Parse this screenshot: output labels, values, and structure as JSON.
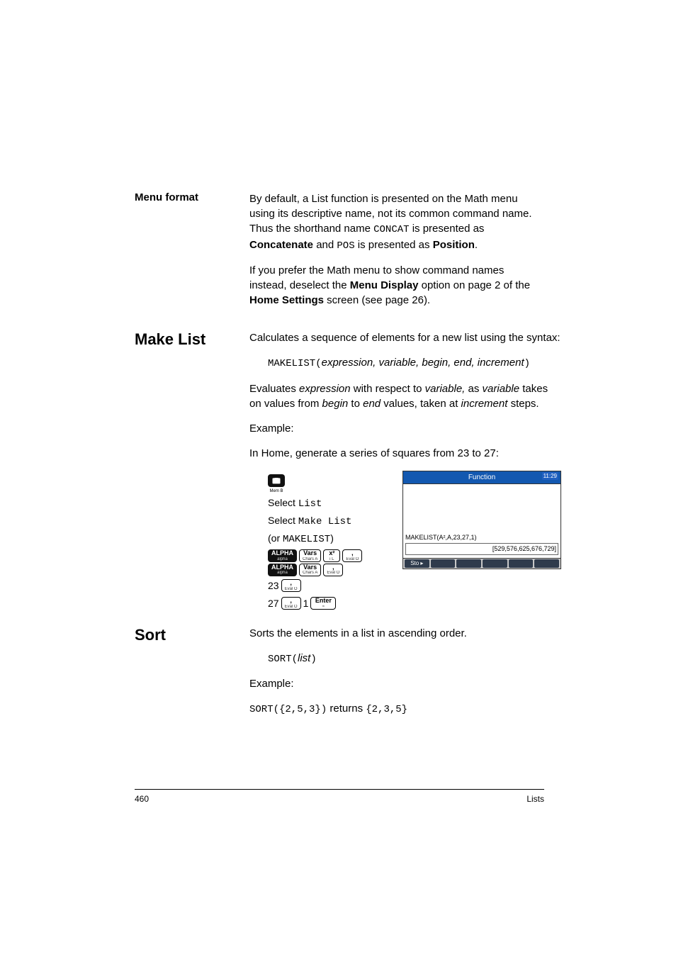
{
  "menu_format": {
    "label": "Menu format",
    "p1_a": "By default, a List function is presented on the Math menu using its descriptive name, not its common command name. Thus the shorthand name ",
    "p1_code1": "CONCAT",
    "p1_b": " is presented as ",
    "p1_bold1": "Concatenate",
    "p1_c": " and ",
    "p1_code2": "POS",
    "p1_d": " is presented as ",
    "p1_bold2": "Position",
    "p1_e": ".",
    "p2_a": "If you prefer the Math menu to show command names instead, deselect the ",
    "p2_bold1": "Menu Display",
    "p2_b": " option on page 2 of the ",
    "p2_bold2": "Home Settings",
    "p2_c": " screen (see page 26)."
  },
  "make_list": {
    "label": "Make List",
    "p1": "Calculates a sequence of elements for a new list using the syntax:",
    "syntax_code": "MAKELIST(",
    "syntax_ital": "expression, variable, begin, end, increment",
    "syntax_close": ")",
    "p2_a": "Evaluates ",
    "p2_i1": "expression",
    "p2_b": " with respect to ",
    "p2_i2": "variable,",
    "p2_c": " as ",
    "p2_i3": "variable",
    "p2_d": " takes on values from ",
    "p2_i4": "begin",
    "p2_e": " to ",
    "p2_i5": "end",
    "p2_f": " values, taken at ",
    "p2_i6": "increment",
    "p2_g": " steps.",
    "example_label": "Example:",
    "example_text": "In Home, generate a series of squares from 23 to 27:",
    "steps": {
      "toolbox_sub": "Mem    B",
      "sel": "Select ",
      "list": "List",
      "makelist": "Make List",
      "or_a": "(or ",
      "or_code": "MAKELIST",
      "or_b": ")",
      "n23": "23",
      "n27": "27",
      "one": "1"
    },
    "keys": {
      "alpha_main": "ALPHA",
      "alpha_sub": "alpha",
      "vars_main": "Vars",
      "vars_sub": "Chars   A",
      "x2_main": "x²",
      "x2_sub": "i      L",
      "comma_main": ",",
      "comma_sub": "Eval    O",
      "enter_main": "Enter",
      "enter_sub": "≈"
    },
    "calc": {
      "title": "Function",
      "time": "11:29",
      "input": "MAKELIST(A²,A,23,27,1)",
      "result": "[529,576,625,676,729]",
      "sto": "Sto ▸"
    }
  },
  "sort": {
    "label": "Sort",
    "p1": "Sorts the elements in a list in ascending order.",
    "syntax_code": "SORT(",
    "syntax_ital": "list",
    "syntax_close": ")",
    "example_label": "Example:",
    "ex_code1": "SORT({2,5,3})",
    "ex_mid": " returns ",
    "ex_code2": "{2,3,5}"
  },
  "footer": {
    "page": "460",
    "section": "Lists"
  }
}
